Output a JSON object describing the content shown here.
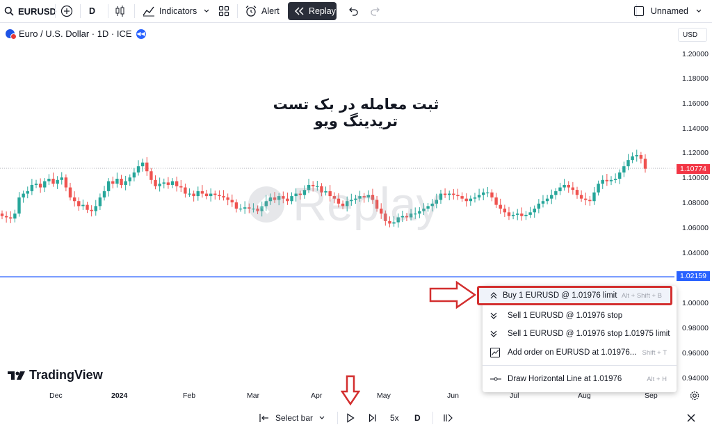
{
  "toolbar": {
    "symbol": "EURUSD",
    "interval": "D",
    "indicators_label": "Indicators",
    "alert_label": "Alert",
    "replay_label": "Replay",
    "layout_name": "Unnamed"
  },
  "legend": {
    "title": "Euro / U.S. Dollar · 1D · ICE"
  },
  "currency_label": "USD",
  "overlay_title": "ثبت معامله در بک تست تریدینگ ویو",
  "watermark_text": "Replay",
  "logo_text": "TradingView",
  "price_axis": [
    "1.20000",
    "1.18000",
    "1.16000",
    "1.14000",
    "1.12000",
    "1.10000",
    "1.08000",
    "1.06000",
    "1.04000",
    "1.00000",
    "0.98000",
    "0.96000",
    "0.94000"
  ],
  "current_price": "1.10774",
  "cursor_price": "1.02159",
  "time_axis": [
    "Dec",
    "2024",
    "Feb",
    "Mar",
    "Apr",
    "May",
    "Jun",
    "Jul",
    "Aug",
    "Sep"
  ],
  "context_menu": [
    {
      "label": "Buy 1 EURUSD @ 1.01976 limit",
      "shortcut": "Alt + Shift + B"
    },
    {
      "label": "Sell 1 EURUSD @ 1.01976 stop",
      "shortcut": ""
    },
    {
      "label": "Sell 1 EURUSD @ 1.01976 stop 1.01975 limit",
      "shortcut": ""
    },
    {
      "label": "Add order on EURUSD at 1.01976...",
      "shortcut": "Shift + T"
    },
    {
      "label": "Draw Horizontal Line at 1.01976",
      "shortcut": "Alt + H"
    }
  ],
  "bottom_bar": {
    "select_bar_label": "Select bar",
    "speed_label": "5x",
    "interval_label": "D"
  },
  "colors": {
    "up": "#26a69a",
    "down": "#ef5350",
    "current_price": "#f23645",
    "cursor_line": "#2962ff",
    "annotation": "#d32f2f"
  },
  "candles": [
    1.07,
    1.069,
    1.068,
    1.072,
    1.085,
    1.088,
    1.09,
    1.095,
    1.096,
    1.093,
    1.098,
    1.1,
    1.096,
    1.099,
    1.101,
    1.093,
    1.085,
    1.082,
    1.078,
    1.079,
    1.075,
    1.074,
    1.078,
    1.085,
    1.09,
    1.098,
    1.096,
    1.1,
    1.095,
    1.098,
    1.101,
    1.105,
    1.11,
    1.113,
    1.106,
    1.099,
    1.094,
    1.096,
    1.097,
    1.095,
    1.098,
    1.094,
    1.093,
    1.088,
    1.088,
    1.086,
    1.09,
    1.088,
    1.086,
    1.088,
    1.087,
    1.086,
    1.085,
    1.083,
    1.081,
    1.076,
    1.076,
    1.077,
    1.076,
    1.076,
    1.074,
    1.078,
    1.082,
    1.085,
    1.083,
    1.086,
    1.084,
    1.082,
    1.086,
    1.088,
    1.087,
    1.091,
    1.095,
    1.094,
    1.094,
    1.089,
    1.09,
    1.086,
    1.084,
    1.08,
    1.078,
    1.082,
    1.083,
    1.084,
    1.086,
    1.085,
    1.087,
    1.083,
    1.076,
    1.072,
    1.066,
    1.064,
    1.065,
    1.069,
    1.07,
    1.069,
    1.072,
    1.072,
    1.074,
    1.076,
    1.078,
    1.08,
    1.083,
    1.088,
    1.087,
    1.088,
    1.087,
    1.086,
    1.084,
    1.082,
    1.084,
    1.085,
    1.087,
    1.089,
    1.089,
    1.085,
    1.079,
    1.076,
    1.073,
    1.07,
    1.071,
    1.072,
    1.07,
    1.071,
    1.073,
    1.076,
    1.08,
    1.082,
    1.084,
    1.087,
    1.09,
    1.093,
    1.095,
    1.093,
    1.091,
    1.087,
    1.084,
    1.083,
    1.082,
    1.089,
    1.096,
    1.099,
    1.098,
    1.099,
    1.1,
    1.105,
    1.11,
    1.115,
    1.118,
    1.119,
    1.116,
    1.108
  ]
}
